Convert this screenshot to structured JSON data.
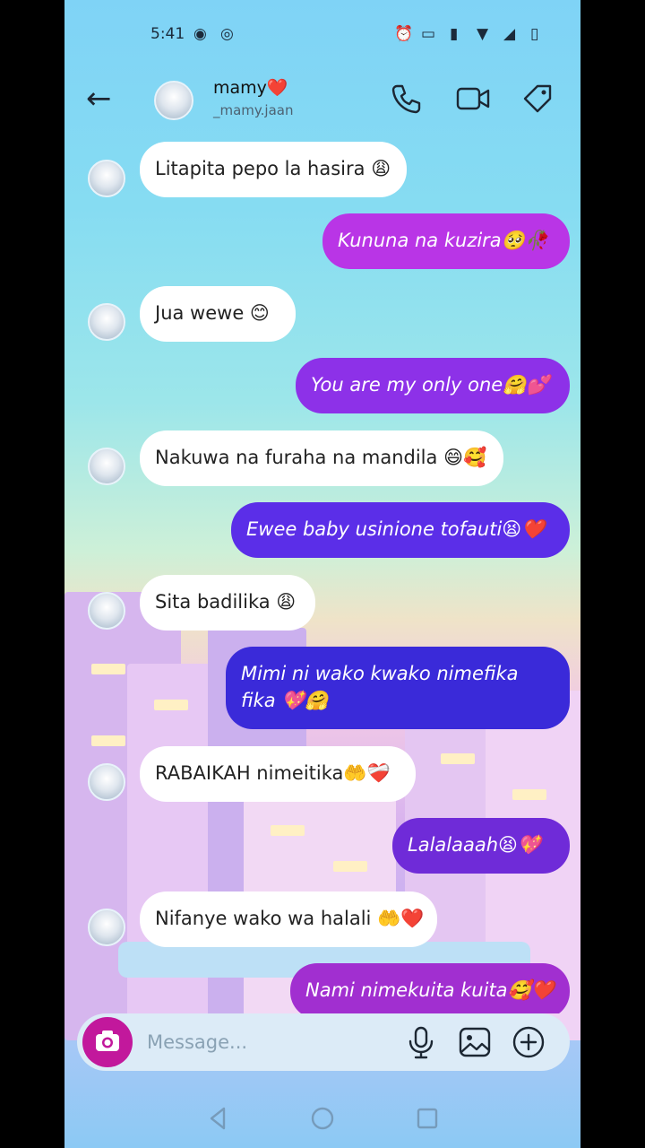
{
  "status_bar": {
    "time": "5:41",
    "icons": [
      "record-icon",
      "vpn-icon",
      "alarm-icon",
      "cast-icon",
      "vibrate-icon",
      "wifi-icon",
      "signal-icon",
      "battery-icon"
    ]
  },
  "header": {
    "name": "mamy❤️",
    "username": "_mamy.jaan",
    "icons": [
      "back-arrow-icon",
      "phone-icon",
      "video-icon",
      "tag-icon"
    ]
  },
  "messages": [
    {
      "dir": "in",
      "text": "Litapita pepo la hasira 😩"
    },
    {
      "dir": "out",
      "text": "Kununa na kuzira🥺🥀"
    },
    {
      "dir": "in",
      "text": "Jua wewe 😊"
    },
    {
      "dir": "out",
      "text": "You are my only one🤗💕"
    },
    {
      "dir": "in",
      "text": "Nakuwa na furaha na mandila 😄🥰"
    },
    {
      "dir": "out",
      "text": "Ewee baby usinione tofauti😫❤️"
    },
    {
      "dir": "in",
      "text": "Sita badilika 😩"
    },
    {
      "dir": "out",
      "text": "Mimi ni wako kwako nimefika fika 💖🤗"
    },
    {
      "dir": "in",
      "text": "RABAIKAH nimeitika🤲❤️‍🩹"
    },
    {
      "dir": "out",
      "text": "Lalalaaah😫💖"
    },
    {
      "dir": "in",
      "text": "Nifanye wako wa halali 🤲❤️"
    },
    {
      "dir": "out",
      "text": "Nami nimekuita kuita🥰❤️"
    }
  ],
  "composer": {
    "placeholder": "Message...",
    "icons": [
      "camera-icon",
      "microphone-icon",
      "gallery-icon",
      "add-icon"
    ]
  },
  "nav_bar": {
    "icons": [
      "back-nav-icon",
      "home-nav-icon",
      "recents-nav-icon"
    ]
  },
  "colors": {
    "camera": "#c2189c",
    "out_top": "#b935e6",
    "out_mid": "#6b2ee8",
    "out_low": "#3a2ad9",
    "out_bottom": "#a12fd0"
  }
}
